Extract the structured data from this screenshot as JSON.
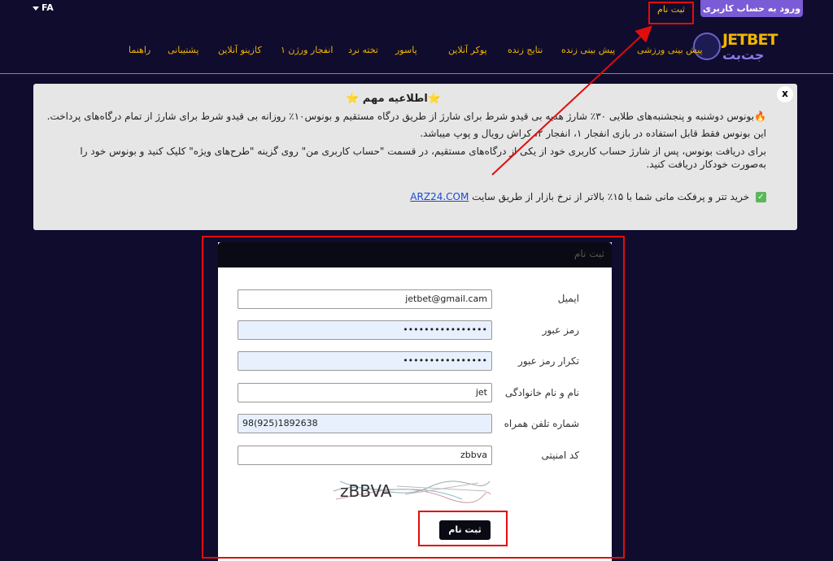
{
  "header": {
    "lang": "FA",
    "login_button": "ورود به حساب کاربری",
    "signup_link": "ثبت نام",
    "logo_en": "JETBET",
    "logo_fa": "جت‌بت",
    "nav": [
      "پیش بینی ورزشی",
      "پیش بینی زنده",
      "نتایج زنده",
      "پوکر آنلاین",
      "پاسور",
      "تخته نرد",
      "انفجار ورژن ۱",
      "کازینو آنلاین",
      "پشتیبانی",
      "راهنما"
    ]
  },
  "notice": {
    "close": "x",
    "title": "⭐اطلاعیه مهم ⭐",
    "line1": "🔥بونوس دوشنبه و پنجشنبه‌های طلایی ۳۰٪ شارژ هدیه بی قیدو شرط برای شارژ از طریق درگاه مستقیم و بونوس۱۰٪ روزانه بی قیدو شرط برای شارژ از تمام درگاه‌های پرداخت.",
    "line2": "این بونوس فقط قابل استفاده در بازی انفجار ۱، انفجار ۲، کراش رویال و پوپ میباشد.",
    "line3": "برای دریافت بونوس، پس از شارژ حساب کاربری خود از یکی از درگاه‌های مستقیم، در قسمت \"حساب کاربری من\" روی گزینه \"طرح‌های ویژه\" کلیک کنید و بونوس خود را",
    "line4": "به‌صورت خودکار دریافت کنید.",
    "line5_text": "خرید تتر و پرفکت مانی شما با ۱۵٪ بالاتر از نرخ بازار از طریق سایت",
    "line5_link": "ARZ24.COM",
    "check": "✓"
  },
  "form": {
    "title": "ثبت نام",
    "fields": [
      {
        "label": "ایمیل",
        "value": "jetbet@gmail.cam"
      },
      {
        "label": "رمز عبور",
        "value": "••••••••••••••••"
      },
      {
        "label": "تکرار رمز عبور",
        "value": "••••••••••••••••"
      },
      {
        "label": "نام و نام خانوادگی",
        "value": "jet"
      },
      {
        "label": "شماره تلفن همراه",
        "value": "98(925)1892638"
      },
      {
        "label": "کد امنیتی",
        "value": "zbbva"
      }
    ],
    "captcha_text": "zBBVA",
    "submit": "ثبت نام"
  },
  "colors": {
    "background": "#0f0c2e",
    "accent": "#f1b500",
    "brand_purple": "#7b5bd6",
    "annotation_red": "#e10d0d"
  }
}
